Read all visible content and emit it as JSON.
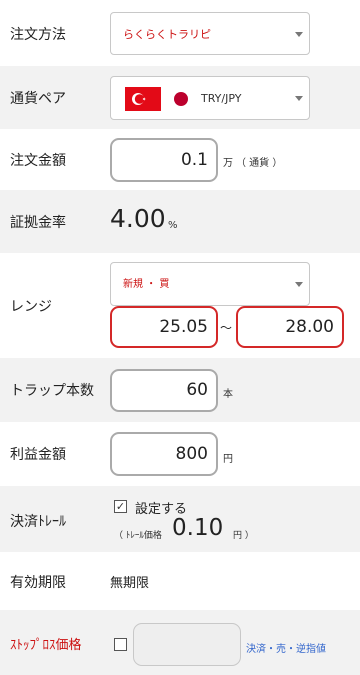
{
  "rows": {
    "order_method": {
      "label": "注文方法",
      "value": "らくらくトラリピ"
    },
    "currency_pair": {
      "label": "通貨ペア",
      "value": "TRY/JPY"
    },
    "order_amount": {
      "label": "注文金額",
      "value": "0.1",
      "unit": "万",
      "unit_note": "（ 通貨 ）"
    },
    "margin_rate": {
      "label": "証拠金率",
      "value": "4.00",
      "unit": "%"
    },
    "range": {
      "label": "レンジ",
      "direction": "新規 ・ 買",
      "low": "25.05",
      "tilde": "～",
      "high": "28.00"
    },
    "trap_count": {
      "label": "トラップ本数",
      "value": "60",
      "unit": "本"
    },
    "profit_amount": {
      "label": "利益金額",
      "value": "800",
      "unit": "円"
    },
    "settlement_trail": {
      "label": "決済ﾄﾚｰﾙ",
      "checkbox_label": "設定する",
      "checked": true,
      "trail_note": "（ ﾄﾚｰﾙ価格",
      "trail_value": "0.10",
      "trail_unit": "円 ）"
    },
    "expiry": {
      "label": "有効期限",
      "value": "無期限"
    },
    "stop_loss": {
      "label": "ｽﾄｯﾌﾟﾛｽ価格",
      "checked": false,
      "value": "",
      "note": "決済・売・逆指値"
    }
  },
  "colors": {
    "accent_red": "#cc1111",
    "link_blue": "#3366cc",
    "row_shade": "#f2f2f2"
  },
  "icons": {
    "flag_tr": "turkey-flag-icon",
    "flag_jp": "japan-flag-icon"
  }
}
